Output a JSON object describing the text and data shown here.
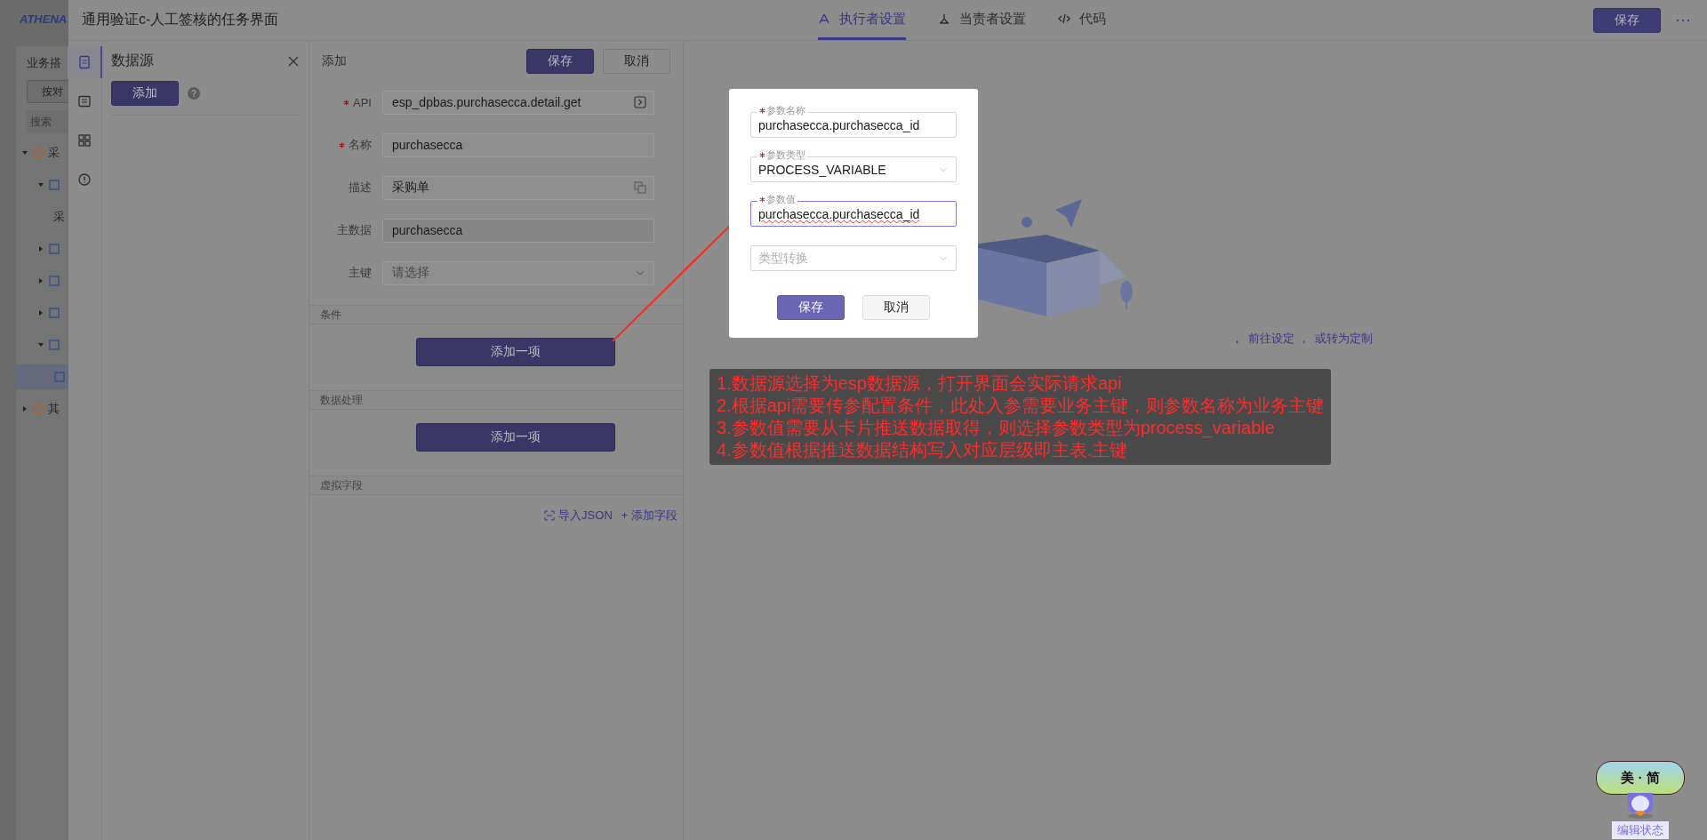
{
  "background_app": {
    "logo": "ATHENA",
    "title": "业务搭",
    "filter_button": "按对",
    "search": {
      "placeholder": "搜索"
    },
    "tree": [
      {
        "label": "采",
        "expanded": true,
        "children": [
          {
            "expanded": true,
            "children": [
              {
                "label": "采"
              }
            ]
          },
          {
            "expanded": false
          },
          {
            "expanded": false
          },
          {
            "expanded": false
          },
          {
            "expanded": true,
            "children": [
              {
                "selected": true
              }
            ]
          }
        ]
      },
      {
        "label": "其",
        "expanded": false
      }
    ]
  },
  "drawer": {
    "title": "通用验证c-人工签核的任务界面",
    "tabs": [
      {
        "label": "执行者设置",
        "selected": true
      },
      {
        "label": "当责者设置",
        "selected": false
      },
      {
        "label": "代码",
        "selected": false
      }
    ],
    "save_button": "保存",
    "more": "···"
  },
  "side_rail": [
    {
      "selected": true
    },
    {
      "selected": false
    },
    {
      "selected": false
    },
    {
      "selected": false
    }
  ],
  "datasource_panel": {
    "title": "数据源",
    "add_button": "添加",
    "help": "?"
  },
  "form": {
    "header": "添加",
    "save_button": "保存",
    "cancel_button": "取消",
    "fields": [
      {
        "label": "API",
        "required": true,
        "value": "esp_dpbas.purchasecca.detail.get",
        "kind": "action"
      },
      {
        "label": "名称",
        "required": true,
        "value": "purchasecca",
        "kind": "text"
      },
      {
        "label": "描述",
        "required": false,
        "value": "采购单",
        "kind": "translate"
      },
      {
        "label": "主数据",
        "required": false,
        "value": "purchasecca",
        "kind": "readonly"
      },
      {
        "label": "主键",
        "required": false,
        "placeholder": "请选择",
        "kind": "select"
      }
    ],
    "sections": [
      {
        "title": "条件",
        "button": "添加一项"
      },
      {
        "title": "数据处理",
        "button": "添加一项"
      },
      {
        "title": "虚拟字段",
        "links": [
          "导入JSON",
          "+ 添加字段"
        ]
      }
    ]
  },
  "empty_state": {
    "parts": [
      {
        "text": "，",
        "kind": "text"
      },
      {
        "text": "前往设定 ，",
        "kind": "link"
      },
      {
        "text": "或转为定制",
        "kind": "link"
      }
    ]
  },
  "dialog": {
    "fields": [
      {
        "label": "参数名称",
        "required": true,
        "value": "purchasecca.purchasecca_id",
        "kind": "input",
        "focused": false
      },
      {
        "label": "参数类型",
        "required": true,
        "value": "PROCESS_VARIABLE",
        "kind": "select",
        "focused": false
      },
      {
        "label": "参数值",
        "required": true,
        "value": "purchasecca.purchasecca_id",
        "kind": "input",
        "focused": true
      },
      {
        "placeholder": "类型转换",
        "kind": "select",
        "focused": false
      }
    ],
    "save_button": "保存",
    "cancel_button": "取消"
  },
  "annotation": [
    "1.数据源选择为esp数据源，打开界面会实际请求api",
    "2.根据api需要传参配置条件，此处入参需要业务主键，则参数名称为业务主键",
    "3.参数值需要从卡片推送数据取得，则选择参数类型为process_variable",
    "4.参数值根据推送数据结构写入对应层级即主表.主键"
  ],
  "mascot": {
    "bubble": "美 · 简",
    "status_label": "编辑状态"
  }
}
